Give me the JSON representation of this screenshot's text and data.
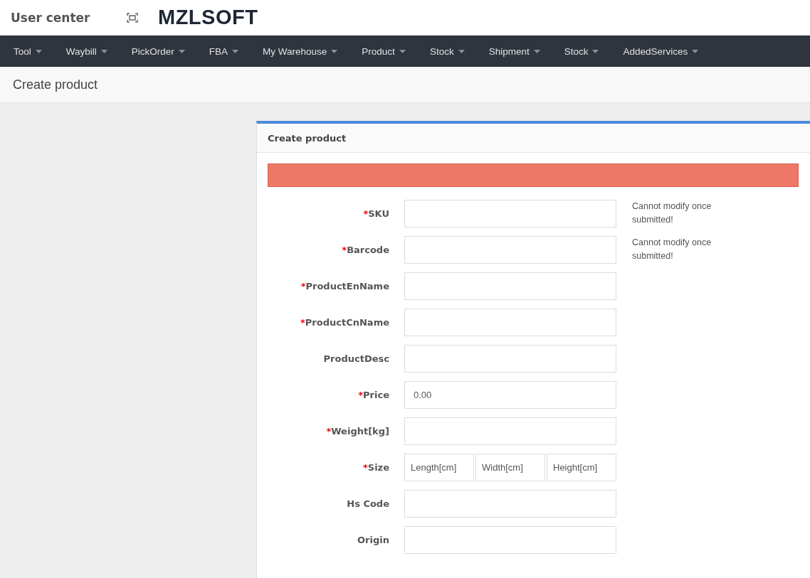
{
  "header": {
    "title": "User center",
    "logo": "MZLSOFT"
  },
  "nav": [
    {
      "label": "Tool"
    },
    {
      "label": "Waybill"
    },
    {
      "label": "PickOrder"
    },
    {
      "label": "FBA"
    },
    {
      "label": "My Warehouse"
    },
    {
      "label": "Product"
    },
    {
      "label": "Stock"
    },
    {
      "label": "Shipment"
    },
    {
      "label": "Stock"
    },
    {
      "label": "AddedServices"
    }
  ],
  "page_title": "Create product",
  "panel": {
    "title": "Create product",
    "fields": [
      {
        "kind": "text",
        "mark": "*",
        "label": "SKU",
        "hint": "Cannot modify once submitted!"
      },
      {
        "kind": "text",
        "mark": "*",
        "label": "Barcode",
        "hint": "Cannot modify once submitted!"
      },
      {
        "kind": "text",
        "mark": "*",
        "label": "ProductEnName"
      },
      {
        "kind": "text",
        "mark": "*",
        "label": "ProductCnName"
      },
      {
        "kind": "text",
        "label": "ProductDesc"
      },
      {
        "kind": "text",
        "mark": "*",
        "label": "Price",
        "value": "0.00"
      },
      {
        "kind": "text",
        "mark": "*",
        "label": "Weight[kg]"
      },
      {
        "kind": "size",
        "mark": "*",
        "label": "Size",
        "placeholders": [
          "Length[cm]",
          "Width[cm]",
          "Height[cm]"
        ]
      },
      {
        "kind": "text",
        "label": "Hs Code"
      },
      {
        "kind": "text",
        "label": "Origin"
      }
    ]
  }
}
